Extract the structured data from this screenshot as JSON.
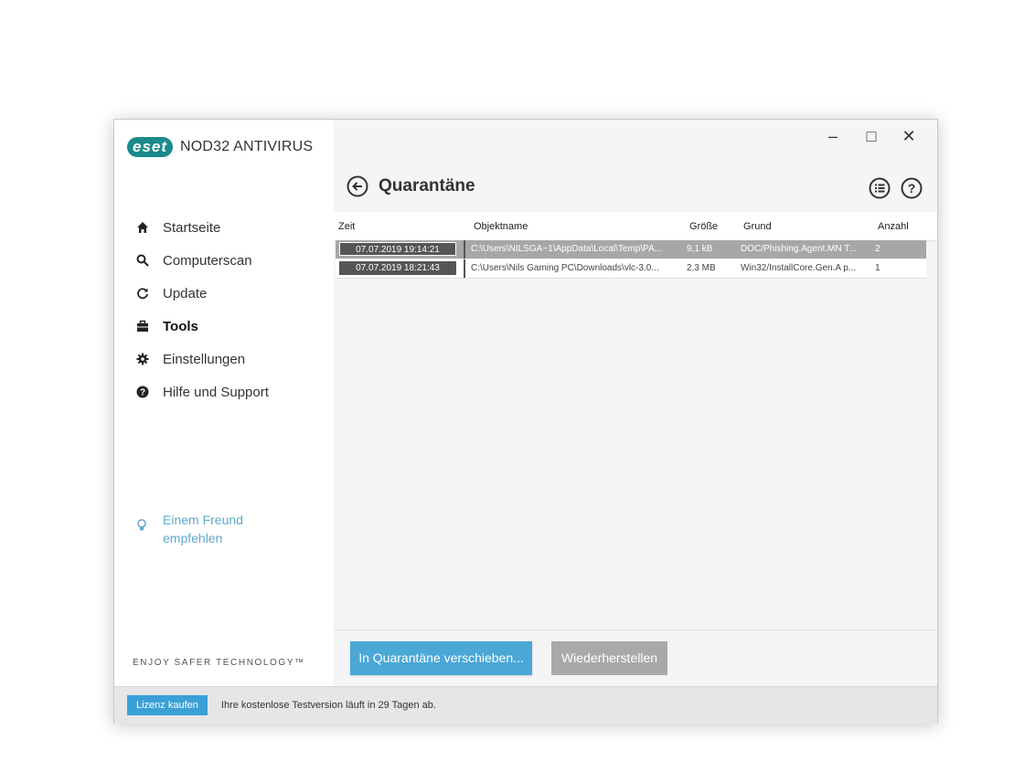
{
  "app": {
    "brand": "eset",
    "product": "NOD32 ANTIVIRUS",
    "tagline": "ENJOY SAFER TECHNOLOGY™",
    "accent_color": "#1b8a8a"
  },
  "window_controls": {
    "minimize": "–",
    "maximize": "□",
    "close": "✕"
  },
  "sidebar": {
    "items": [
      {
        "label": "Startseite",
        "icon": "home-icon"
      },
      {
        "label": "Computerscan",
        "icon": "search-icon"
      },
      {
        "label": "Update",
        "icon": "refresh-icon"
      },
      {
        "label": "Tools",
        "icon": "toolbox-icon",
        "active": true
      },
      {
        "label": "Einstellungen",
        "icon": "gear-icon"
      },
      {
        "label": "Hilfe und Support",
        "icon": "help-icon"
      }
    ],
    "recommend": {
      "line1": "Einem Freund",
      "line2": "empfehlen",
      "icon": "lightbulb-icon"
    }
  },
  "page": {
    "title": "Quarantäne"
  },
  "table": {
    "columns": [
      "Zeit",
      "Objektname",
      "Größe",
      "Grund",
      "Anzahl"
    ],
    "rows": [
      {
        "time": "07.07.2019 19:14:21",
        "object": "C:\\Users\\NILSGA~1\\AppData\\Local\\Temp\\PA...",
        "size": "9,1 kB",
        "reason": "DOC/Phishing.Agent.MN T...",
        "count": "2",
        "selected": true
      },
      {
        "time": "07.07.2019 18:21:43",
        "object": "C:\\Users\\Nils Gaming PC\\Downloads\\vlc-3.0...",
        "size": "2,3 MB",
        "reason": "Win32/InstallCore.Gen.A p...",
        "count": "1",
        "selected": false
      }
    ]
  },
  "actions": {
    "quarantine_label": "In Quarantäne verschieben...",
    "restore_label": "Wiederherstellen"
  },
  "statusbar": {
    "buy_label": "Lizenz kaufen",
    "trial_text": "Ihre kostenlose Testversion läuft in 29 Tagen ab."
  }
}
